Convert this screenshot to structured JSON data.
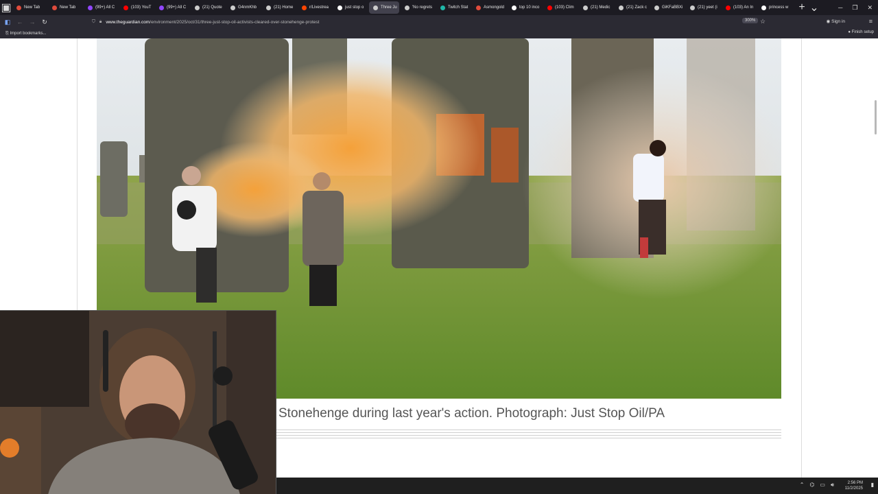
{
  "browser": {
    "tabs": [
      {
        "label": "New Tab",
        "color": "#e04b3c"
      },
      {
        "label": "New Tab",
        "color": "#e04b3c"
      },
      {
        "label": "(99+) All C",
        "color": "#9146ff"
      },
      {
        "label": "(103) YouT",
        "color": "#ff0000"
      },
      {
        "label": "(99+) All C",
        "color": "#9146ff"
      },
      {
        "label": "(21) Quote",
        "color": "#cccccc"
      },
      {
        "label": "G4nmKhb",
        "color": "#cccccc"
      },
      {
        "label": "(21) Home",
        "color": "#cccccc"
      },
      {
        "label": "r/Livestrea",
        "color": "#ff4500"
      },
      {
        "label": "just stop o",
        "color": "#ffffff"
      },
      {
        "label": "Three Ju",
        "color": "#cccccc",
        "active": true
      },
      {
        "label": "'No regrets",
        "color": "#cccccc"
      },
      {
        "label": "Twitch Stat",
        "color": "#1fb7a8"
      },
      {
        "label": "Asmongold",
        "color": "#e04b3c"
      },
      {
        "label": "top 10 inco",
        "color": "#ffffff"
      },
      {
        "label": "(103) Clim",
        "color": "#ff0000"
      },
      {
        "label": "(21) Medic",
        "color": "#cccccc"
      },
      {
        "label": "(21) Zack c",
        "color": "#cccccc"
      },
      {
        "label": "GiKFaBBXi",
        "color": "#cccccc"
      },
      {
        "label": "(21) yeet (i",
        "color": "#cccccc"
      },
      {
        "label": "(103) An In",
        "color": "#ff0000"
      },
      {
        "label": "princess w",
        "color": "#ffffff"
      }
    ],
    "url_domain": "www.theguardian.com",
    "url_path": "/environment/2025/oct/31/three-just-stop-oil-activists-cleared-over-stonehenge-protest",
    "zoom": "300%",
    "sign_in": "Sign in",
    "bookmarks_label": "Import bookmarks...",
    "finish_setup": "Finish setup"
  },
  "article": {
    "caption": "Stonehenge during last year's action. Photograph: Just Stop Oil/PA"
  },
  "taskbar": {
    "time": "2:56 PM",
    "date": "11/2/2025"
  }
}
